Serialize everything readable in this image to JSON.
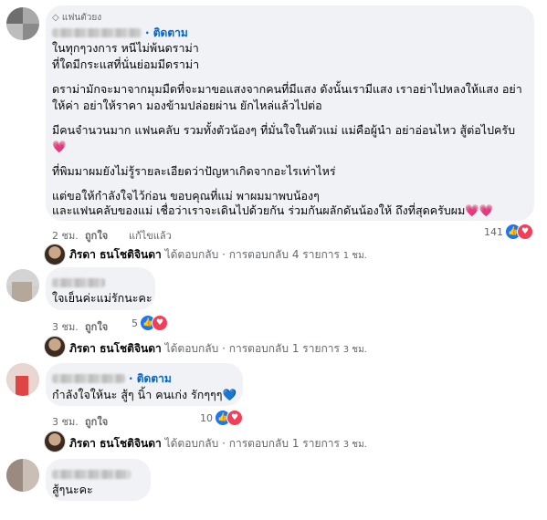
{
  "comments": [
    {
      "badge": "แฟนตัวยง",
      "follow": "· ติดตาม",
      "lines": [
        "ในทุกๆวงการ หนีไม่พ้นดราม่า",
        "ที่ใดมีกระแสที่นั่นย่อมมีดราม่า",
        "ดราม่ามักจะมาจากมุมมืดที่จะมาขอแสงจากคนที่มีแสง ดังนั้นเรามีแสง เราอย่าไปหลงให้แสง อย่า",
        "ให้ค่า อย่าให้ราคา มองข้ามปล่อยผ่าน ยักไหล่แล้วไปต่อ",
        "มีคนจำนวนมาก แฟนคลับ รวมทั้งตัวน้องๆ ที่มั่นใจในตัวแม่ แม่คือผู้นำ อย่าอ่อนไหว สู้ต่อไปครับ",
        "ที่พิมมาผมยังไม่รู้รายละเอียดว่าปัญหาเกิดจากอะไรเท่าไหร่",
        "แต่ขอให้กำลังใจไว้ก่อน ขอบคุณที่แม่ พาผมมาพบน้องๆ",
        "และแฟนคลับของแม่ เชื่อว่าเราจะเดินไปด้วยกัน ร่วมกันผลักดันน้องให้ ถึงที่สุดครับผม"
      ],
      "time": "2 ชม.",
      "like": "ถูกใจ",
      "edited": "แก้ไขแล้ว",
      "reactions": "141"
    },
    {
      "lines": [
        "ใจเย็นค่ะแม่รักนะคะ"
      ],
      "time": "3 ชม.",
      "like": "ถูกใจ",
      "reactions": "5"
    },
    {
      "follow": "· ติดตาม",
      "lines": [
        "กำลังใจให้นะ สู้ๆ นิ้า คนเก่ง รักๆๆๆ"
      ],
      "time": "3 ชม.",
      "like": "ถูกใจ",
      "reactions": "10"
    },
    {
      "lines": [
        "สู้ๆนะคะ"
      ]
    }
  ],
  "replies": [
    {
      "name": "ภิรดา ธนโชติจินดา",
      "text": "ได้ตอบกลับ · การตอบกลับ 4 รายการ",
      "time": "1 ชม."
    },
    {
      "name": "ภิรดา ธนโชติจินดา",
      "text": "ได้ตอบกลับ · การตอบกลับ 1 รายการ",
      "time": "3 ชม."
    },
    {
      "name": "ภิรดา ธนโชติจินดา",
      "text": "ได้ตอบกลับ · การตอบกลับ 1 รายการ",
      "time": "3 ชม."
    }
  ],
  "colors": {
    "link": "#0064d1",
    "bubble": "#f0f2f5",
    "muted": "#65676b",
    "like": "#1877f2",
    "love": "#f33e58"
  },
  "icons": {
    "like": "thumbs-up-icon",
    "love": "heart-icon",
    "fan": "diamond-icon"
  }
}
